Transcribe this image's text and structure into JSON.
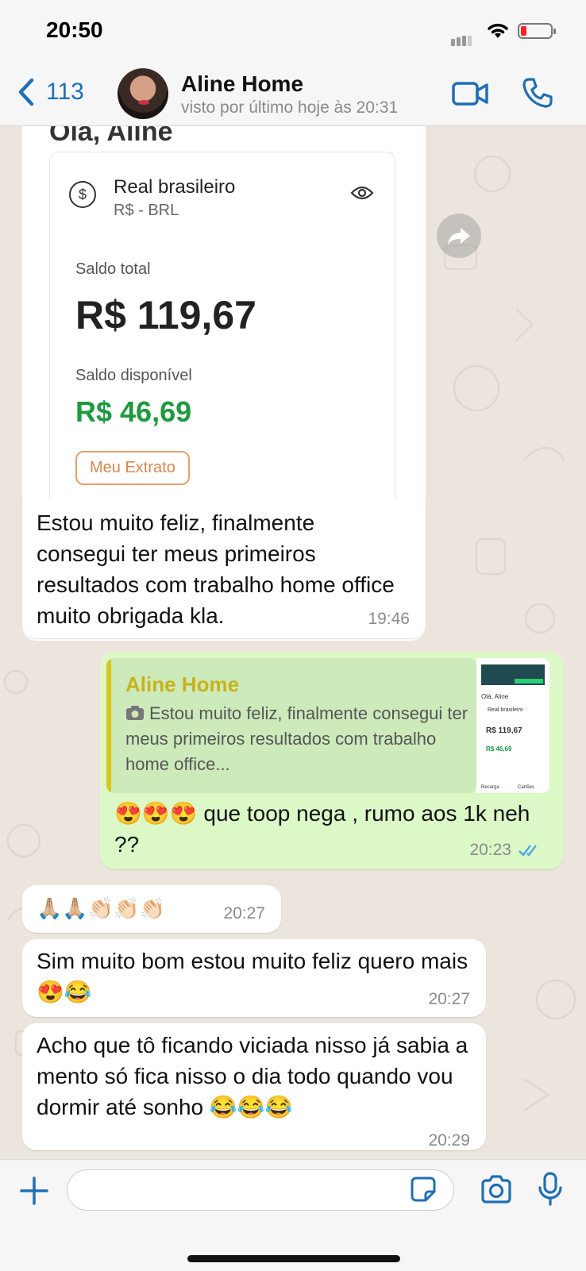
{
  "status_bar": {
    "time": "20:50"
  },
  "header": {
    "back_count": "113",
    "contact_name": "Aline Home",
    "contact_status": "visto por último hoje às 20:31"
  },
  "shared_screenshot": {
    "greeting": "Olá, Aline",
    "currency_name": "Real brasileiro",
    "currency_code": "R$ - BRL",
    "total_label": "Saldo total",
    "total_value": "R$ 119,67",
    "available_label": "Saldo disponível",
    "available_value": "R$ 46,69",
    "statement_button": "Meu Extrato"
  },
  "messages": [
    {
      "direction": "in",
      "text": "Estou muito feliz, finalmente consegui ter meus primeiros resultados com trabalho home office muito obrigada kla.",
      "time": "19:46"
    },
    {
      "direction": "out",
      "reply_to_name": "Aline Home",
      "reply_to_text": "Estou muito feliz, finalmente consegui ter meus primeiros resultados com trabalho home office...",
      "text": "😍😍😍 que toop nega , rumo aos 1k neh ??",
      "time": "20:23",
      "read": true
    },
    {
      "direction": "in",
      "text": "🙏🏼🙏🏼👏🏻👏🏻👏🏻",
      "time": "20:27"
    },
    {
      "direction": "in",
      "text": "Sim muito bom estou muito feliz quero mais 😍😂",
      "time": "20:27"
    },
    {
      "direction": "in",
      "text": "Acho que tô ficando viciada nisso já sabia a mento só fica nisso o dia todo quando vou dormir até sonho 😂😂😂",
      "time": "20:29"
    }
  ],
  "thumbnail": {
    "greeting": "Olá, Aline",
    "currency_name": "Real brasileiro",
    "total_value": "R$ 119,67",
    "available_value": "R$ 46,69",
    "bottom_left": "Recarga",
    "bottom_right": "Cartões"
  },
  "colors": {
    "outgoing_bubble": "#dcf8c6",
    "incoming_bubble": "#ffffff",
    "accent": "#1e6fb5",
    "reply_name": "#c9b21a",
    "available_green": "#1d9a3f",
    "read_ticks": "#4fa3e6"
  },
  "icons": [
    "back-chevron-icon",
    "video-call-icon",
    "phone-icon",
    "forward-icon",
    "camera-small-icon",
    "read-ticks-icon",
    "plus-icon",
    "sticker-icon",
    "camera-icon",
    "microphone-icon"
  ]
}
